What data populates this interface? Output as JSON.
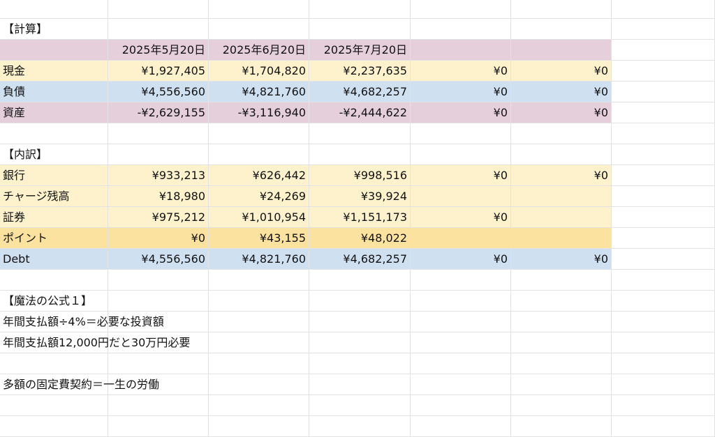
{
  "colors": {
    "header": "#e5cfdb",
    "cash": "#fdf2cc",
    "debt": "#cfe0f0",
    "asset": "#e5cfdb",
    "point": "#fbe29e",
    "grid": "#e2e2e2"
  },
  "sections": {
    "calc": "【計算】",
    "breakdown": "【内訳】"
  },
  "dates": [
    "2025年5月20日",
    "2025年6月20日",
    "2025年7月20日"
  ],
  "calc_rows": [
    {
      "label": "現金",
      "values": [
        "¥1,927,405",
        "¥1,704,820",
        "¥2,237,635",
        "¥0",
        "¥0"
      ]
    },
    {
      "label": "負債",
      "values": [
        "¥4,556,560",
        "¥4,821,760",
        "¥4,682,257",
        "¥0",
        "¥0"
      ]
    },
    {
      "label": "資産",
      "values": [
        "-¥2,629,155",
        "-¥3,116,940",
        "-¥2,444,622",
        "¥0",
        "¥0"
      ]
    }
  ],
  "breakdown_rows": [
    {
      "label": "銀行",
      "values": [
        "¥933,213",
        "¥626,442",
        "¥998,516",
        "¥0",
        "¥0"
      ]
    },
    {
      "label": "チャージ残高",
      "values": [
        "¥18,980",
        "¥24,269",
        "¥39,924",
        "",
        ""
      ]
    },
    {
      "label": "証券",
      "values": [
        "¥975,212",
        "¥1,010,954",
        "¥1,151,173",
        "¥0",
        ""
      ]
    },
    {
      "label": "ポイント",
      "values": [
        "¥0",
        "¥43,155",
        "¥48,022",
        "",
        ""
      ]
    },
    {
      "label": "Debt",
      "values": [
        "¥4,556,560",
        "¥4,821,760",
        "¥4,682,257",
        "¥0",
        "¥0"
      ]
    }
  ],
  "notes": {
    "formula_title": "【魔法の公式１】",
    "formula_line1": "年間支払額÷4%＝必要な投資額",
    "formula_line2": "年間支払額12,000円だと30万円必要",
    "fixed_cost": "多額の固定費契約＝一生の労働"
  }
}
